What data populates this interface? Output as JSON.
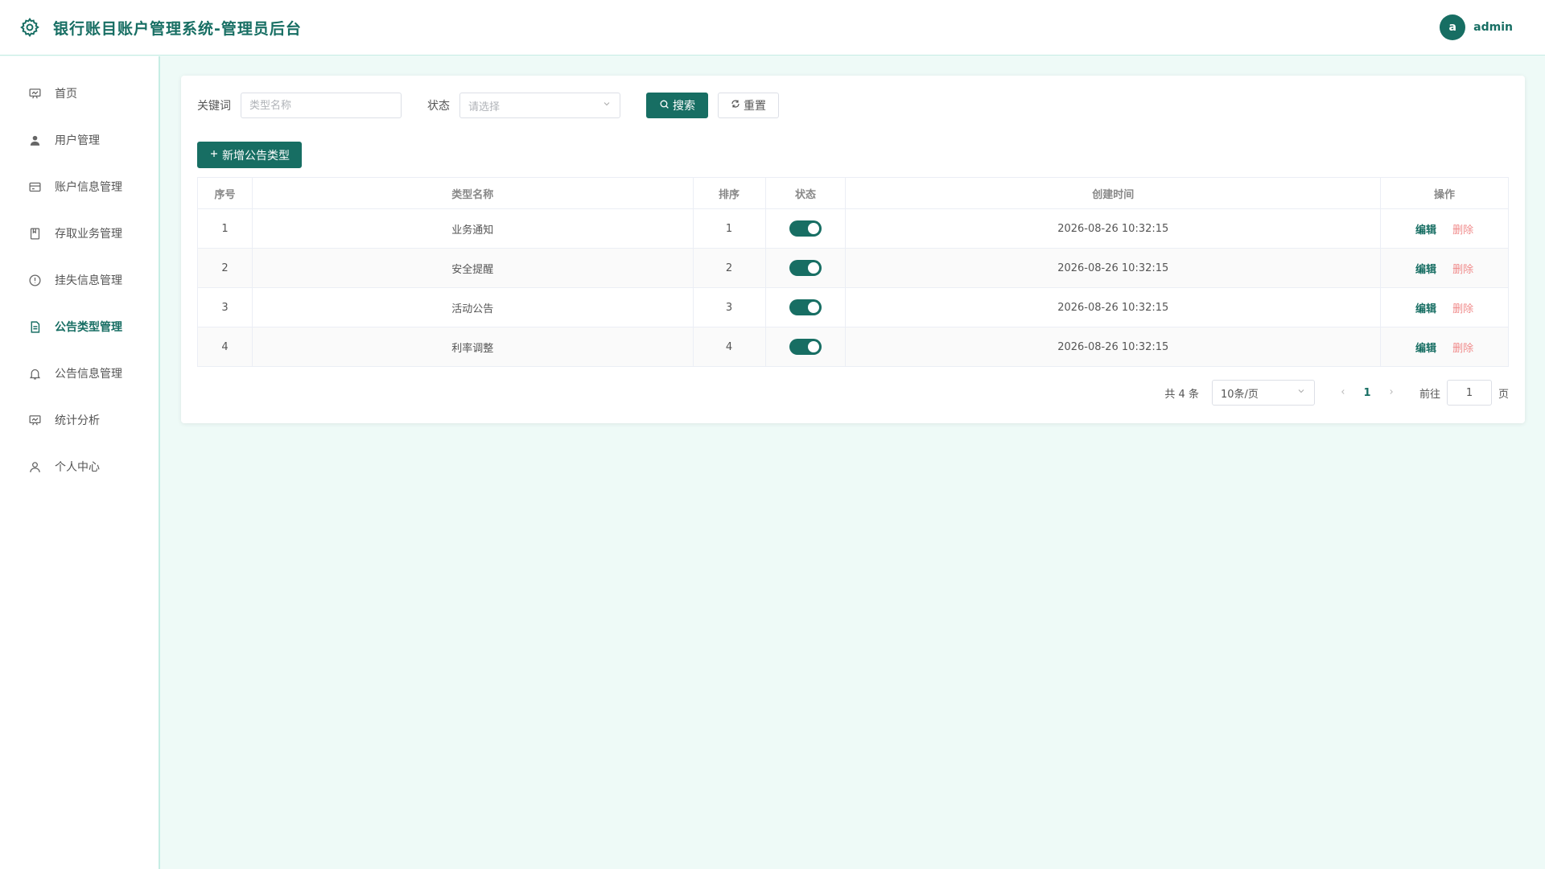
{
  "header": {
    "title": "银行账目账户管理系统-管理员后台",
    "avatar_letter": "a",
    "username": "admin"
  },
  "sidebar": {
    "items": [
      {
        "label": "首页",
        "icon": "dashboard-icon"
      },
      {
        "label": "用户管理",
        "icon": "user-icon"
      },
      {
        "label": "账户信息管理",
        "icon": "credit-card-icon"
      },
      {
        "label": "存取业务管理",
        "icon": "notebook-icon"
      },
      {
        "label": "挂失信息管理",
        "icon": "warning-icon"
      },
      {
        "label": "公告类型管理",
        "icon": "document-icon",
        "active": true
      },
      {
        "label": "公告信息管理",
        "icon": "bell-icon"
      },
      {
        "label": "统计分析",
        "icon": "chart-icon"
      },
      {
        "label": "个人中心",
        "icon": "person-icon"
      }
    ]
  },
  "filters": {
    "keyword_label": "关键词",
    "keyword_placeholder": "类型名称",
    "status_label": "状态",
    "status_placeholder": "请选择",
    "search_label": "搜索",
    "reset_label": "重置"
  },
  "add_button_label": "新增公告类型",
  "table": {
    "columns": [
      "序号",
      "类型名称",
      "排序",
      "状态",
      "创建时间",
      "操作"
    ],
    "rows": [
      {
        "index": "1",
        "name": "业务通知",
        "sort": "1",
        "enabled": true,
        "created": "2026-08-26 10:32:15"
      },
      {
        "index": "2",
        "name": "安全提醒",
        "sort": "2",
        "enabled": true,
        "created": "2026-08-26 10:32:15"
      },
      {
        "index": "3",
        "name": "活动公告",
        "sort": "3",
        "enabled": true,
        "created": "2026-08-26 10:32:15"
      },
      {
        "index": "4",
        "name": "利率调整",
        "sort": "4",
        "enabled": true,
        "created": "2026-08-26 10:32:15"
      }
    ],
    "edit_label": "编辑",
    "delete_label": "删除"
  },
  "pagination": {
    "total_text": "共 4 条",
    "page_size": "10条/页",
    "current_page": "1",
    "goto_label": "前往",
    "goto_value": "1",
    "page_suffix": "页"
  },
  "colors": {
    "primary": "#176e63",
    "danger": "#f08a8a",
    "background": "#eefaf7"
  }
}
